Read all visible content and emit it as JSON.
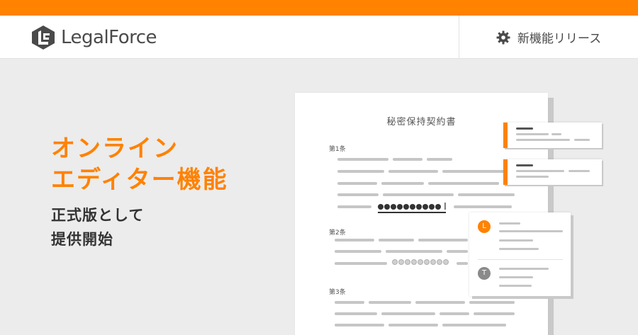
{
  "brand": {
    "name": "LegalForce",
    "logo_icon": "legalforce-logo-icon",
    "color": "#ff8200"
  },
  "header": {
    "release_label": "新機能リリース",
    "release_icon": "gear-icon"
  },
  "hero": {
    "title_lines": [
      "オンライン",
      "エディター機能"
    ],
    "subtitle_lines": [
      "正式版として",
      "提供開始"
    ]
  },
  "document": {
    "title": "秘密保持契約書",
    "articles": [
      "第1条",
      "第2条",
      "第3条"
    ],
    "cursor_glyph": "I"
  },
  "comments": [
    {
      "avatar": "L",
      "color": "#ff8200"
    },
    {
      "avatar": "T",
      "color": "#8a8a8a"
    }
  ]
}
